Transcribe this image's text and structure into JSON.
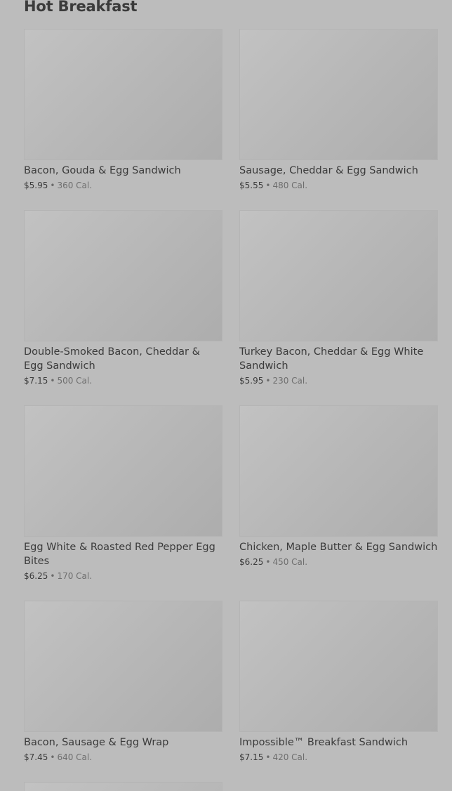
{
  "section": {
    "title": "Hot Breakfast"
  },
  "items": [
    {
      "name": "Bacon, Gouda & Egg Sandwich",
      "price": "$5.95",
      "separator": "•",
      "calories": "360 Cal."
    },
    {
      "name": "Sausage, Cheddar & Egg Sandwich",
      "price": "$5.55",
      "separator": "•",
      "calories": "480 Cal."
    },
    {
      "name": "Double-Smoked Bacon, Cheddar & Egg Sandwich",
      "price": "$7.15",
      "separator": "•",
      "calories": "500 Cal."
    },
    {
      "name": "Turkey Bacon, Cheddar & Egg White Sandwich",
      "price": "$5.95",
      "separator": "•",
      "calories": "230 Cal."
    },
    {
      "name": "Egg White & Roasted Red Pepper Egg Bites",
      "price": "$6.25",
      "separator": "•",
      "calories": "170 Cal."
    },
    {
      "name": "Chicken, Maple Butter & Egg Sandwich",
      "price": "$6.25",
      "separator": "•",
      "calories": "450 Cal."
    },
    {
      "name": "Bacon, Sausage & Egg Wrap",
      "price": "$7.45",
      "separator": "•",
      "calories": "640 Cal."
    },
    {
      "name": "Impossible™ Breakfast Sandwich",
      "price": "$7.15",
      "separator": "•",
      "calories": "420 Cal."
    }
  ]
}
